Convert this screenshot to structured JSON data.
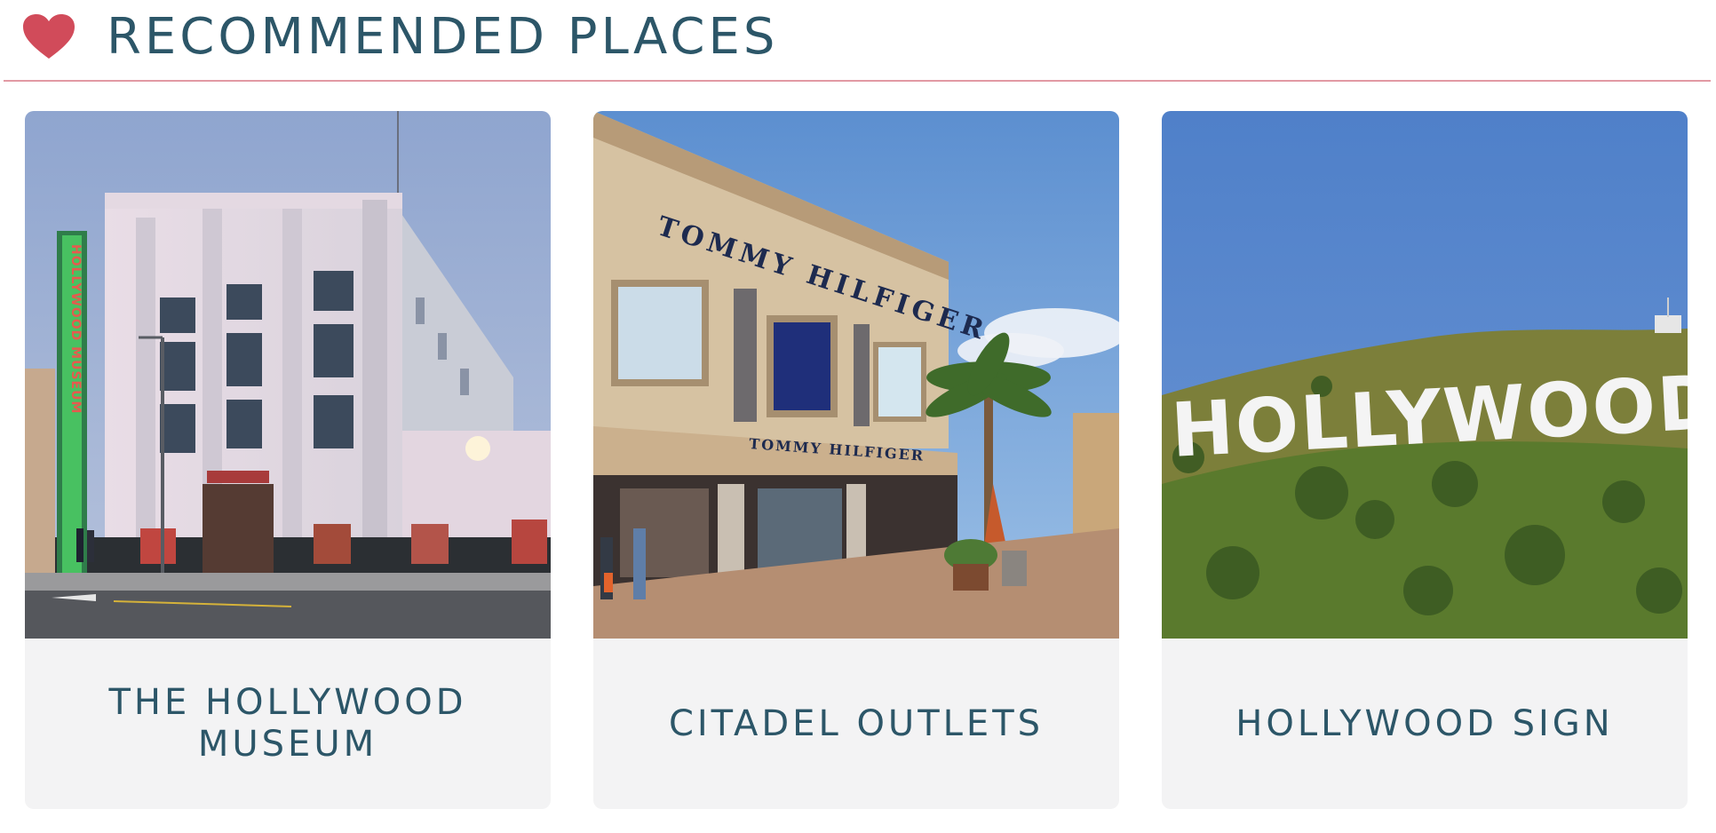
{
  "header": {
    "title": "RECOMMENDED PLACES",
    "icon": "heart-icon",
    "accent_color": "#d14b5a",
    "title_color": "#2c5668"
  },
  "places": [
    {
      "name": "THE HOLLYWOOD MUSEUM",
      "line1": "THE HOLLYWOOD",
      "line2": "MUSEUM",
      "sign_text": "HOLLYWOOD MUSEUM"
    },
    {
      "name": "CITADEL OUTLETS",
      "sign_top": "TOMMY HILFIGER",
      "sign_bottom": "TOMMY HILFIGER"
    },
    {
      "name": "HOLLYWOOD SIGN",
      "sign_text": "HOLLYWOOD"
    }
  ]
}
